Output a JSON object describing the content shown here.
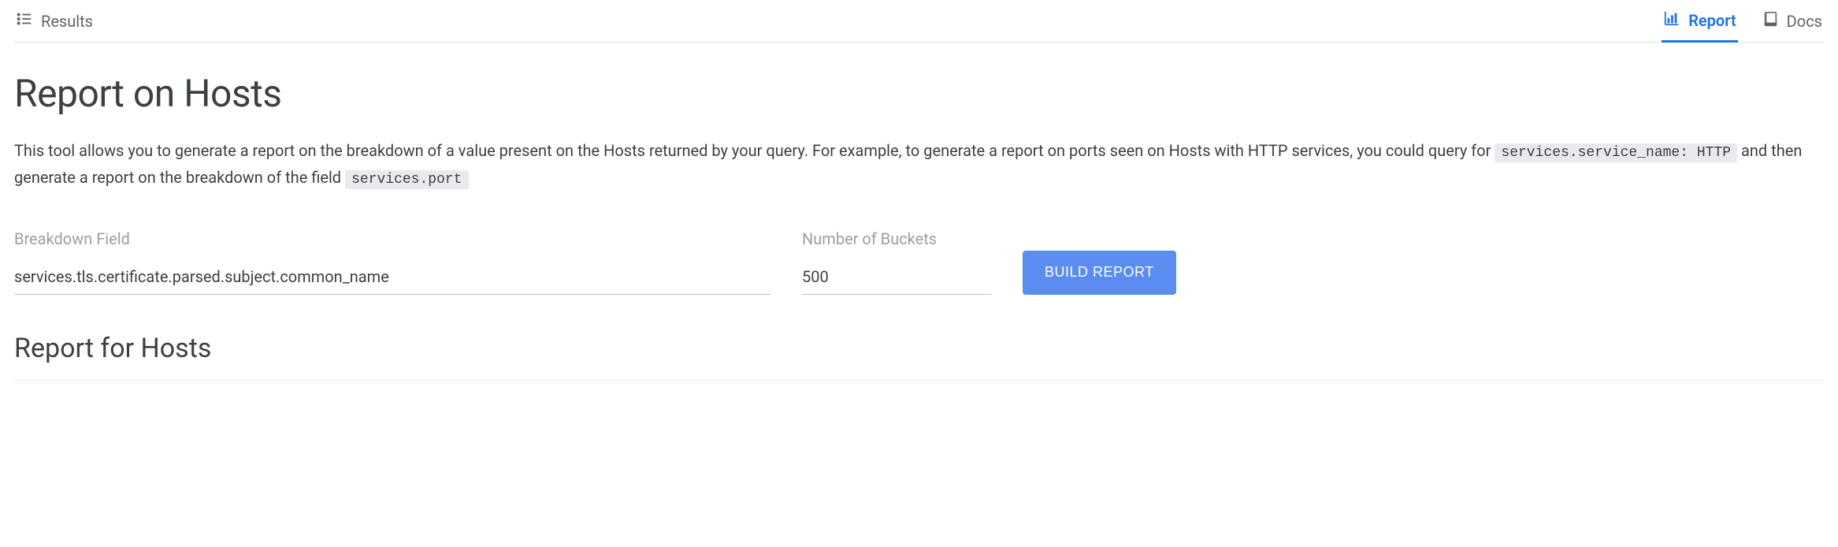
{
  "nav": {
    "results": "Results",
    "report": "Report",
    "docs": "Docs"
  },
  "page": {
    "title": "Report on Hosts",
    "desc_part1": "This tool allows you to generate a report on the breakdown of a value present on the Hosts returned by your query. For example, to generate a report on ports seen on Hosts with HTTP services, you could query for ",
    "desc_code1": "services.service_name: HTTP",
    "desc_part2": " and then generate a report on the breakdown of the field ",
    "desc_code2": "services.port"
  },
  "form": {
    "breakdown_label": "Breakdown Field",
    "breakdown_value": "services.tls.certificate.parsed.subject.common_name",
    "buckets_label": "Number of Buckets",
    "buckets_value": "500",
    "build_label": "BUILD REPORT"
  },
  "section": {
    "report_title": "Report for Hosts"
  }
}
